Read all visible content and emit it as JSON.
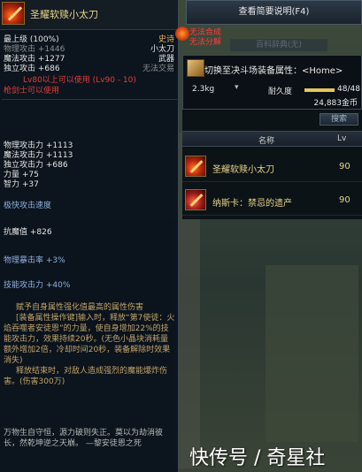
{
  "tooltip": {
    "title": "圣耀软赎小太刀",
    "stats_top": [
      {
        "left": "最上级 (100%)",
        "right": "史诗"
      },
      {
        "left": "物理攻击 +1446",
        "right": "小太刀"
      },
      {
        "left": "魔法攻击 +1277",
        "right": "武器"
      },
      {
        "left": "独立攻击 +686",
        "right": "无法交易"
      }
    ],
    "level_req": "Lv80以上可以使用 (Lv90 - 10)",
    "class_req": "枪剑士可以使用",
    "power": [
      "物理攻击力 +1113",
      "魔法攻击力 +1113",
      "独立攻击力 +686",
      "力量 +75",
      "智力 +37"
    ],
    "attack_speed": "极快攻击速度",
    "resist": "抗魔值 +826",
    "crit": "物理暴击率 +3%",
    "skill_atk": "技能攻击力 +40%",
    "desc": [
      "赋予自身属性强化值最高的属性伤害",
      "[装备属性操作键]输入时，释放“第7使徒：火焰吞噬者安徒恩”的力量，使自身增加22%的技能攻击力，效果持续20秒。(无色小晶块消耗量额外增加2倍，冷却时间20秒，装备解除时效果消失)",
      "释放结束时，对敌人造成强烈的魔能爆炸伤害。(伤害300万)"
    ],
    "quote": "万物生自守恒，源力破则失正。莫以为劫消彼长，然乾坤逆之天崩。 —黎安徒恩之死"
  },
  "summary_button": "查看简要说明(F4)",
  "warnings": [
    "无法合成",
    "无法分解"
  ],
  "faint_tab": "百科辞典(无)",
  "equip_switch": {
    "label": "切换至决斗场装备属性：<Home>",
    "weight": "2.3kg",
    "durability_label": "耐久度",
    "durability_value": "48/48",
    "durability_fraction": 1.0,
    "gold": "24,883金币"
  },
  "list": {
    "search_label": "搜索",
    "header_name": "名称",
    "header_lv": "Lv",
    "items": [
      {
        "name": "圣耀软赎小太刀",
        "lv": "90"
      },
      {
        "name": "纳斯卡：禁忌的遗产",
        "lv": "90"
      }
    ]
  },
  "watermark": "快传号 / 奇星社"
}
